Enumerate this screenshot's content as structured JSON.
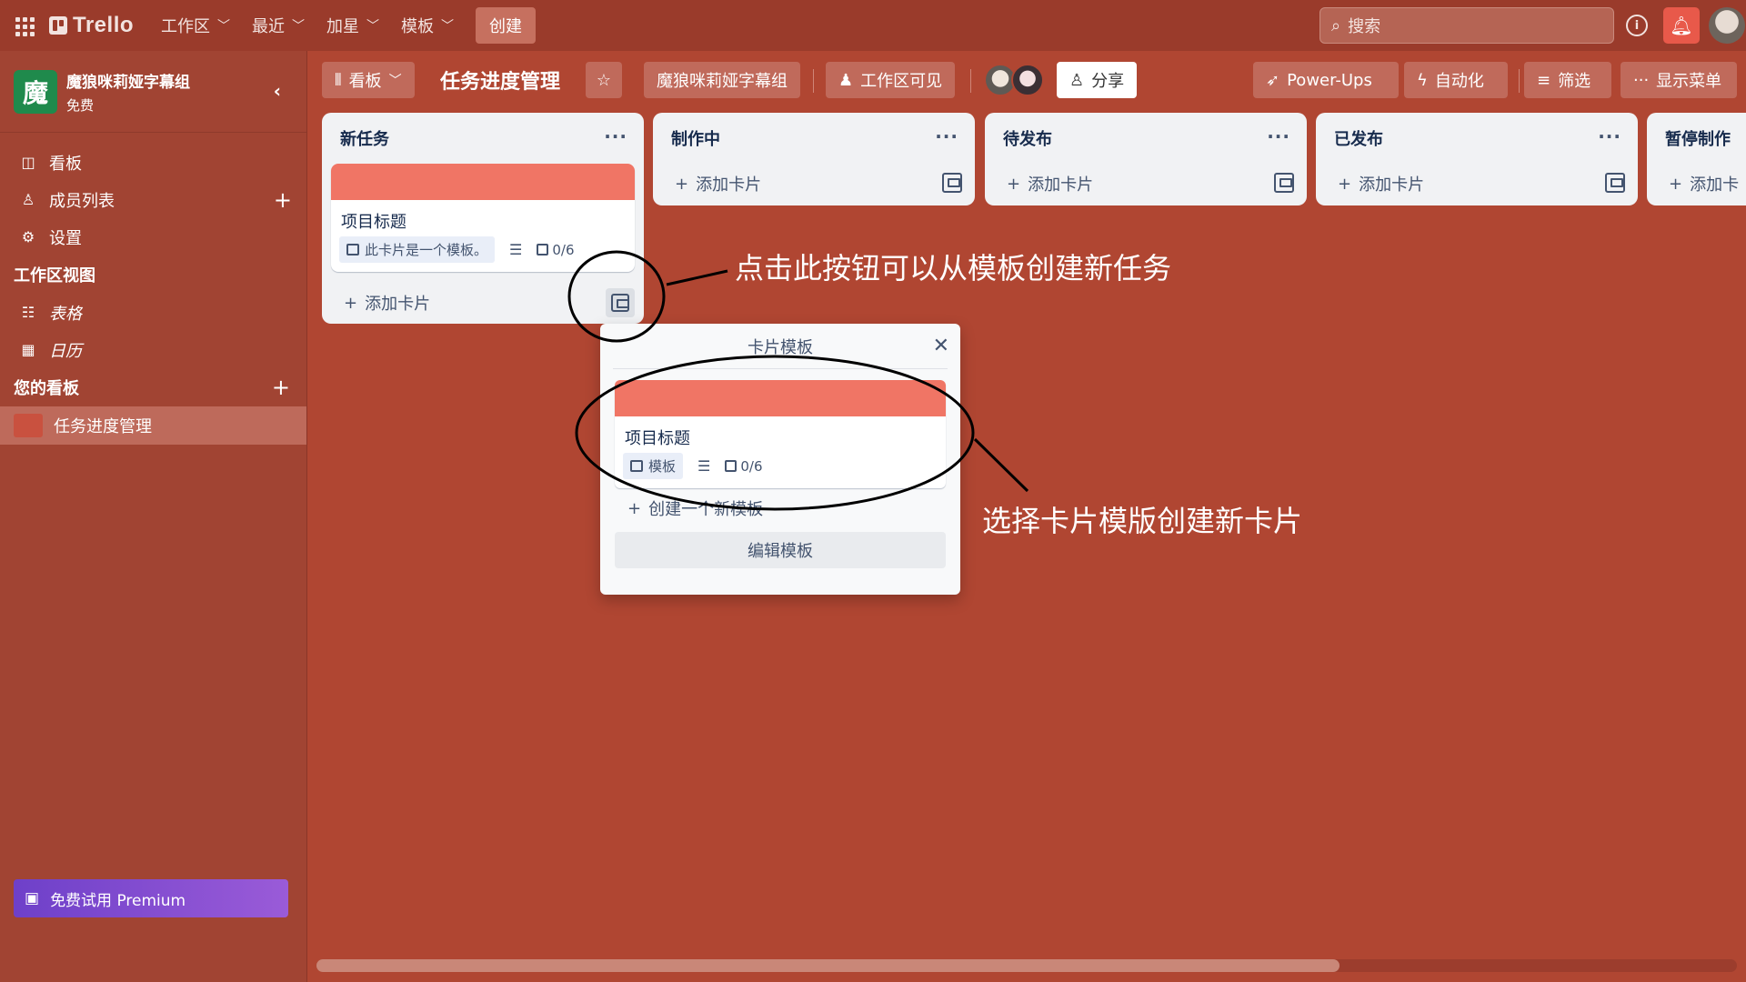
{
  "topbar": {
    "logo_text": "Trello",
    "nav": [
      "工作区",
      "最近",
      "加星",
      "模板"
    ],
    "create_label": "创建",
    "search_placeholder": "搜索"
  },
  "sidebar": {
    "workspace_initial": "魔",
    "workspace_name": "魔狼咪莉娅字幕组",
    "workspace_plan": "免费",
    "items": [
      {
        "label": "看板",
        "icon": "board-icon"
      },
      {
        "label": "成员列表",
        "icon": "members-icon"
      },
      {
        "label": "设置",
        "icon": "gear-icon"
      }
    ],
    "views_heading": "工作区视图",
    "views": [
      {
        "label": "表格",
        "icon": "table-icon"
      },
      {
        "label": "日历",
        "icon": "calendar-icon"
      }
    ],
    "boards_heading": "您的看板",
    "boards": [
      {
        "label": "任务进度管理",
        "color": "#c9513f"
      }
    ],
    "premium_label": "免费试用 Premium"
  },
  "board_header": {
    "view_label": "看板",
    "title": "任务进度管理",
    "workspace_label": "魔狼咪莉娅字幕组",
    "visibility_label": "工作区可见",
    "share_label": "分享",
    "powerups_label": "Power-Ups",
    "automation_label": "自动化",
    "filter_label": "筛选",
    "menu_label": "显示菜单"
  },
  "lists": [
    {
      "title": "新任务",
      "add_label": "添加卡片",
      "card": {
        "title": "项目标题",
        "template_badge": "此卡片是一个模板。",
        "checklist": "0/6",
        "cover_color": "#f07565"
      }
    },
    {
      "title": "制作中",
      "add_label": "添加卡片"
    },
    {
      "title": "待发布",
      "add_label": "添加卡片"
    },
    {
      "title": "已发布",
      "add_label": "添加卡片"
    },
    {
      "title": "暂停制作",
      "add_label": "添加卡"
    }
  ],
  "popover": {
    "title": "卡片模板",
    "card_title": "项目标题",
    "card_badge": "模板",
    "card_checklist": "0/6",
    "create_label": "创建一个新模板",
    "edit_label": "编辑模板"
  },
  "annotations": {
    "button_hint": "点击此按钮可以从模板创建新任务",
    "select_hint": "选择卡片模版创建新卡片"
  },
  "colors": {
    "board_bg": "#b04632",
    "topbar_bg": "#9a3b2b",
    "card_cover": "#f07565",
    "notification": "#e8594a",
    "premium": "#6e40c9",
    "workspace_avatar": "#1f8a4c"
  }
}
